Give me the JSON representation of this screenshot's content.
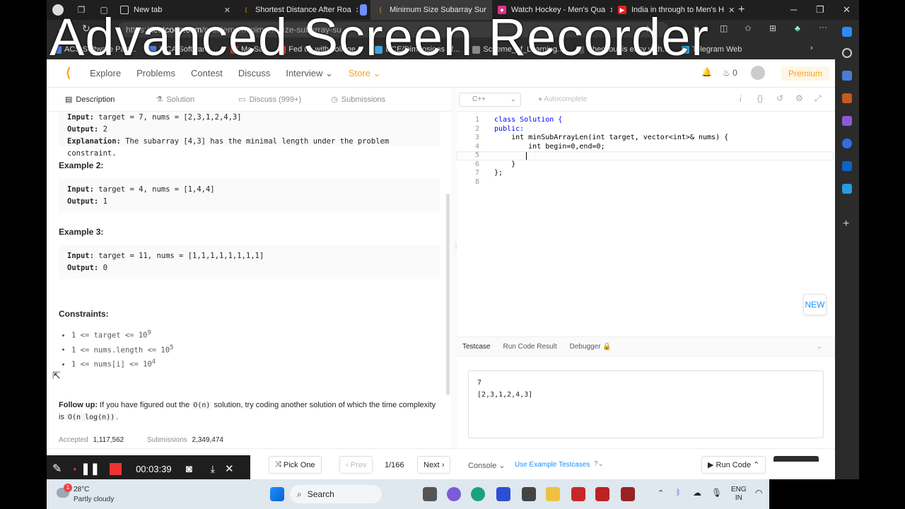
{
  "browser": {
    "tabs": [
      {
        "title": "New tab",
        "active": false
      },
      {
        "title": "Shortest Distance After Roa",
        "active": false
      },
      {
        "title": "Minimum Size Subarray Sur",
        "active": true
      },
      {
        "title": "Watch Hockey - Men's Qua",
        "active": false
      },
      {
        "title": "India in through to Men's H",
        "active": false
      }
    ],
    "url_prefix": "https://",
    "url_host": "leetcode.com",
    "url_path": "/problems/minimum-size-subarray-su",
    "favorites": [
      "ACS Software Part...",
      "MCA Software ...",
      "Mc Sat",
      "Fed up with college...",
      "DCE/Dimensions of...",
      "Scheme_of_Learning...",
      "Checkout is easy with...",
      "Telegram Web"
    ]
  },
  "lc_nav": {
    "links": [
      "Explore",
      "Problems",
      "Contest",
      "Discuss",
      "Interview",
      "Store"
    ],
    "streak": "0",
    "premium": "Premium"
  },
  "desc_tabs": [
    "Description",
    "Solution",
    "Discuss (999+)",
    "Submissions"
  ],
  "problem": {
    "ex1": {
      "input": "target = 7, nums = [2,3,1,2,4,3]",
      "output": "2",
      "explanation": "The subarray [4,3] has the minimal length under the problem constraint."
    },
    "ex2_title": "Example 2:",
    "ex2": {
      "input": "target = 4, nums = [1,4,4]",
      "output": "1"
    },
    "ex3_title": "Example 3:",
    "ex3": {
      "input": "target = 11, nums = [1,1,1,1,1,1,1,1]",
      "output": "0"
    },
    "labels": {
      "input": "Input:",
      "output": "Output:",
      "explanation": "Explanation:"
    },
    "constraints_title": "Constraints:",
    "constraints": [
      {
        "text": "1 <= target <= 10",
        "sup": "9"
      },
      {
        "text": "1 <= nums.length <= 10",
        "sup": "5"
      },
      {
        "text": "1 <= nums[i] <= 10",
        "sup": "4"
      }
    ],
    "followup_label": "Follow up:",
    "followup_a": "If you have figured out the",
    "followup_code1": "O(n)",
    "followup_b": "solution, try coding another solution of which the time complexity is",
    "followup_code2": "O(n log(n))",
    "followup_c": ".",
    "accepted_label": "Accepted",
    "accepted_value": "1,117,562",
    "submissions_label": "Submissions",
    "submissions_value": "2,349,474"
  },
  "editor": {
    "language": "C++",
    "autocomplete": "Autocomplete",
    "line_numbers": [
      "1",
      "2",
      "3",
      "4",
      "5",
      "6",
      "7",
      "8"
    ],
    "lines": [
      "class Solution {",
      "public:",
      "    int minSubArrayLen(int target, vector<int>& nums) {",
      "        int begin=0,end=0;",
      "        ",
      "",
      "    }",
      "};"
    ],
    "new_badge": "NEW"
  },
  "console": {
    "tabs": [
      "Testcase",
      "Run Code Result",
      "Debugger"
    ],
    "testcase_lines": [
      "7",
      "[2,3,1,2,4,3]"
    ]
  },
  "bottom": {
    "pick_one": "Pick One",
    "prev": "Prev",
    "page": "1/166",
    "next": "Next",
    "console": "Console",
    "use_example": "Use Example Testcases",
    "run_code": "Run Code"
  },
  "recorder": {
    "title": "Advanced Screen Recorder",
    "timer": "00:03:39"
  },
  "taskbar": {
    "weather_temp": "28°C",
    "weather_desc": "Partly cloudy",
    "weather_badge": "1",
    "search": "Search",
    "lang1": "ENG",
    "lang2": "IN"
  }
}
